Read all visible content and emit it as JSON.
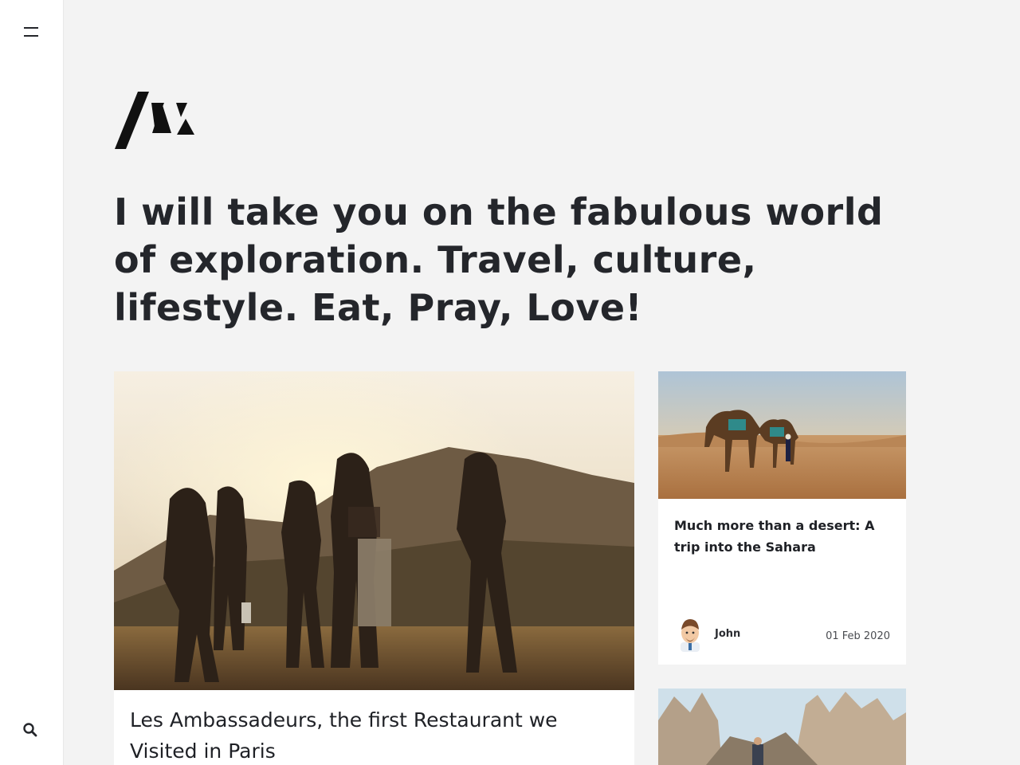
{
  "sidebar": {
    "menu_icon": "hamburger-menu-icon",
    "search_icon": "search-icon"
  },
  "logo": {
    "icon": "brand-logo-mark"
  },
  "hero": {
    "tagline": "I will take you on the fabulous world of exploration. Travel, culture, lifestyle. Eat, Pray, Love!"
  },
  "posts": {
    "featured": {
      "title": "Les Ambassadeurs, the first Restaurant we Visited in Paris"
    },
    "cards": [
      {
        "title": "Much more than a desert: A trip into the Sahara",
        "author": "John",
        "date": "01 Feb 2020"
      }
    ]
  },
  "colors": {
    "background": "#f3f3f3",
    "sidebar": "#ffffff",
    "text": "#24262b"
  }
}
